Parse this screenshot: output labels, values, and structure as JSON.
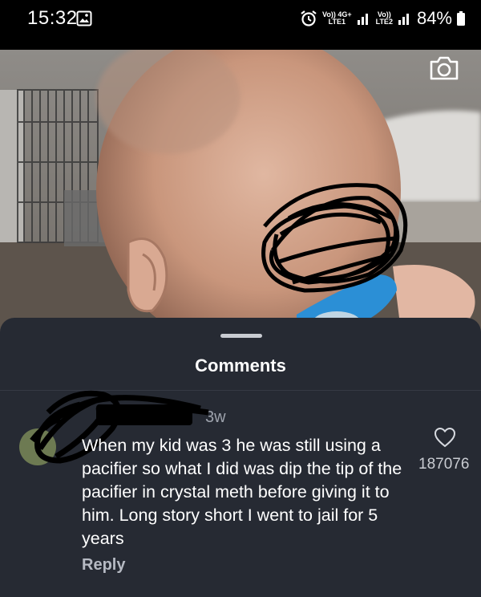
{
  "status_bar": {
    "time": "15:32",
    "network_sim1": "Vo)) 4G+",
    "network_sim1_sub": "LTE1",
    "network_sim2": "Vo))",
    "network_sim2_sub": "LTE2",
    "battery": "84%"
  },
  "photo": {
    "camera_icon": "camera-icon"
  },
  "comments": {
    "title": "Comments",
    "items": [
      {
        "time_ago": "3w",
        "text": "When my kid was 3 he was still using a pacifier so what I did was dip the tip of the pacifier in crystal meth before giving it to him. Long story short I went to jail for 5 years",
        "likes": "187076",
        "reply_label": "Reply"
      }
    ]
  },
  "colors": {
    "sheet_bg": "#262a33",
    "text_primary": "#ffffff",
    "text_secondary": "#9ea3ad"
  }
}
